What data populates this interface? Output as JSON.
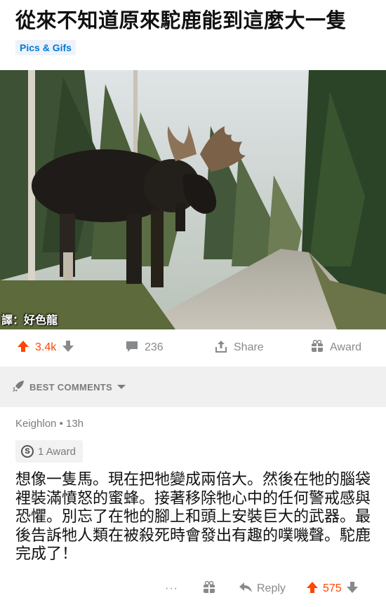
{
  "post": {
    "title": "從來不知道原來駝鹿能到這麼大一隻",
    "flair": "Pics & Gifs",
    "image_caption": "譯：好色龍"
  },
  "actions": {
    "score": "3.4k",
    "comments": "236",
    "share": "Share",
    "award": "Award"
  },
  "best_comments": {
    "label": "BEST COMMENTS"
  },
  "comment": {
    "author": "Keighlon",
    "age": "13h",
    "award_label": "1 Award",
    "award_badge": "S",
    "body": "想像一隻馬。現在把牠變成兩倍大。然後在牠的腦袋裡裝滿憤怒的蜜蜂。接著移除牠心中的任何警戒感與恐懼。別忘了在牠的腳上和頭上安裝巨大的武器。最後告訴牠人類在被殺死時會發出有趣的噗嘰聲。駝鹿完成了！",
    "more": "···",
    "reply": "Reply",
    "score": "575"
  },
  "colors": {
    "upvote": "#ff4500",
    "flair_text": "#0079d3",
    "flair_bg": "#eef3fb",
    "muted": "#878a8c",
    "best_bar_bg": "#f0f0f1"
  },
  "icons": [
    "upvote-arrow-icon",
    "downvote-arrow-icon",
    "comment-bubble-icon",
    "share-icon",
    "gift-icon",
    "rocket-icon",
    "chevron-down-icon",
    "reply-arrow-icon",
    "more-dots-icon"
  ]
}
